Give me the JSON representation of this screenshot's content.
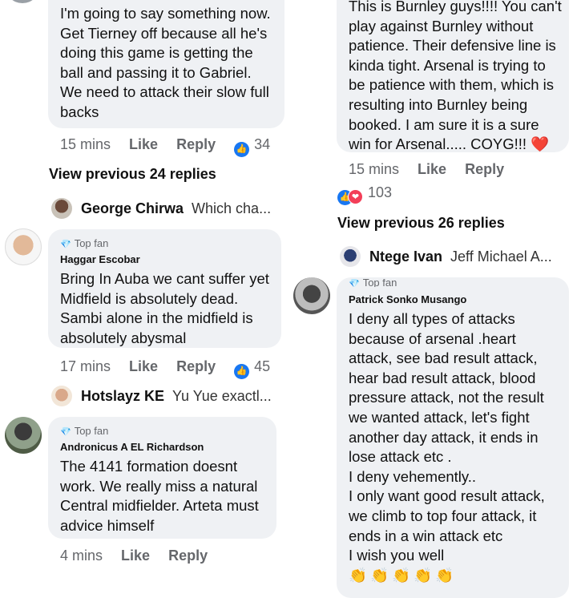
{
  "left": {
    "comment1": {
      "text": "I'm going to say something now.\nGet Tierney off because all he's\ndoing this game is getting the\nball and passing it to Gabriel.\nWe need to attack their slow full\nbacks",
      "time": "15 mins",
      "like": "Like",
      "reply": "Reply",
      "reactions": "34"
    },
    "view_previous": "View previous 24 replies",
    "reply_george": {
      "name": "George Chirwa",
      "text": "Which cha..."
    },
    "comment2": {
      "badge": "Top fan",
      "author": "Haggar Escobar",
      "text": "Bring In Auba we cant suffer yet\nMidfield is absolutely dead.\nSambi alone in the midfield is\nabsolutely abysmal",
      "time": "17 mins",
      "like": "Like",
      "reply": "Reply",
      "reactions": "45"
    },
    "reply_hotslayz": {
      "name": "Hotslayz KE",
      "text": "Yu Yue exactl..."
    },
    "comment3": {
      "badge": "Top fan",
      "author": "Andronicus A EL Richardson",
      "text": "The  4141 formation doesnt\nwork. We really miss a natural\nCentral midfielder. Arteta must\nadvice himself",
      "time": "4 mins",
      "like": "Like",
      "reply": "Reply"
    }
  },
  "right": {
    "comment1": {
      "text": "This is Burnley guys!!!! You can't\nplay against Burnley without\npatience. Their defensive line is\nkinda tight. Arsenal is trying to\nbe patience with them, which is\nresulting into Burnley being\nbooked. I am sure it is a sure\nwin for Arsenal..... COYG!!!",
      "heart": "❤️",
      "time": "15 mins",
      "like": "Like",
      "reply": "Reply",
      "reactions": "103"
    },
    "view_previous": "View previous 26 replies",
    "reply_ntege": {
      "name": "Ntege Ivan",
      "text": "Jeff Michael A..."
    },
    "comment2": {
      "badge": "Top fan",
      "author": "Patrick Sonko Musango",
      "text": "I deny all types of attacks\nbecause of arsenal .heart\nattack, see bad result attack,\nhear bad result attack, blood\npressure attack, not the result\nwe wanted attack, let's fight\nanother day attack, it ends in\nlose attack etc .\nI deny vehemently..\nI only want good result attack,\nwe climb to top four attack, it\nends in a win attack etc\nI wish you well",
      "emojis": "👏👏👏👏👏"
    }
  },
  "icons": {
    "like": "👍",
    "love": "❤",
    "gem": "💎"
  },
  "colors": {
    "bubble": "#eff1f4",
    "like_blue": "#1877f2",
    "love_red": "#f33e58",
    "meta_gray": "#65676b"
  }
}
